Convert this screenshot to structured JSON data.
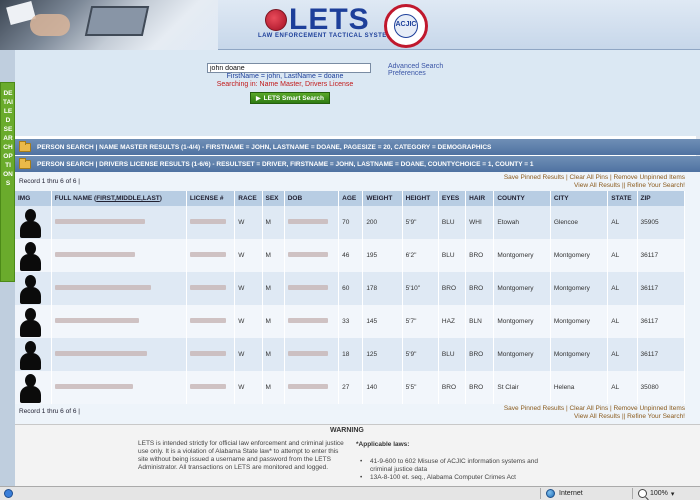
{
  "header": {
    "logo_text": "LETS",
    "logo_subtitle": "LAW ENFORCEMENT TACTICAL SYSTEM",
    "seal_text": "ACJIC"
  },
  "side_strip": {
    "label": "DETAILED SEARCH OPTIONS"
  },
  "search": {
    "value": "john doane",
    "query_echo": "FirstName = john, LastName = doane",
    "scope": "Searching in: Name Master, Drivers License",
    "advanced_link": "Advanced Search",
    "preferences_link": "Preferences",
    "smart_button_label": "LETS Smart Search"
  },
  "result_bars": [
    "PERSON SEARCH | NAME MASTER RESULTS (1-4/4) - FIRSTNAME = JOHN, LASTNAME = DOANE, PAGESIZE = 20, CATEGORY = DEMOGRAPHICS",
    "PERSON SEARCH | DRIVERS LICENSE RESULTS (1-6/6) - RESULTSET = DRIVER, FIRSTNAME = JOHN, LASTNAME = DOANE, COUNTYCHOICE = 1, COUNTY = 1"
  ],
  "pager": {
    "top": "Record 1 thru 6 of 6 |",
    "bottom": "Record 1 thru 6 of 6 |"
  },
  "pin_links": {
    "save_pinned": "Save Pinned Results",
    "clear_pins": "Clear All Pins",
    "remove_unpinned": "Remove Unpinned Items",
    "view_all": "View All Results",
    "refine": "Refine Your Search!"
  },
  "table": {
    "headers": {
      "img": "IMG",
      "full_name_prefix": "FULL NAME (",
      "full_name_link": "FIRST,MIDDLE,LAST",
      "full_name_suffix": ")",
      "license": "LICENSE #",
      "race": "RACE",
      "sex": "SEX",
      "dob": "DOB",
      "age": "AGE",
      "weight": "WEIGHT",
      "height": "HEIGHT",
      "eyes": "EYES",
      "hair": "HAIR",
      "county": "COUNTY",
      "city": "CITY",
      "state": "STATE",
      "zip": "ZIP"
    },
    "rows": [
      {
        "race": "W",
        "sex": "M",
        "age": "70",
        "weight": "200",
        "height": "5'9\"",
        "eyes": "BLU",
        "hair": "WHI",
        "county": "Etowah",
        "city": "Glencoe",
        "state": "AL",
        "zip": "35905"
      },
      {
        "race": "W",
        "sex": "M",
        "age": "46",
        "weight": "195",
        "height": "6'2\"",
        "eyes": "BLU",
        "hair": "BRO",
        "county": "Montgomery",
        "city": "Montgomery",
        "state": "AL",
        "zip": "36117"
      },
      {
        "race": "W",
        "sex": "M",
        "age": "60",
        "weight": "178",
        "height": "5'10\"",
        "eyes": "BRO",
        "hair": "BRO",
        "county": "Montgomery",
        "city": "Montgomery",
        "state": "AL",
        "zip": "36117"
      },
      {
        "race": "W",
        "sex": "M",
        "age": "33",
        "weight": "145",
        "height": "5'7\"",
        "eyes": "HAZ",
        "hair": "BLN",
        "county": "Montgomery",
        "city": "Montgomery",
        "state": "AL",
        "zip": "36117"
      },
      {
        "race": "W",
        "sex": "M",
        "age": "18",
        "weight": "125",
        "height": "5'9\"",
        "eyes": "BLU",
        "hair": "BRO",
        "county": "Montgomery",
        "city": "Montgomery",
        "state": "AL",
        "zip": "36117"
      },
      {
        "race": "W",
        "sex": "M",
        "age": "27",
        "weight": "140",
        "height": "5'5\"",
        "eyes": "BRO",
        "hair": "BRO",
        "county": "St Clair",
        "city": "Helena",
        "state": "AL",
        "zip": "35080"
      }
    ]
  },
  "warning": {
    "title": "WARNING",
    "text": "LETS is intended strictly for official law enforcement and criminal justice use only. It is a violation of Alabama State law* to attempt to enter this site without being issued a username and password from the LETS Administrator. All transactions on LETS are monitored and logged.",
    "laws_title": "*Applicable laws:",
    "laws": [
      "41-9-600 to 602 Misuse of ACJIC information systems and criminal justice data",
      "13A-8-100 et. seq., Alabama Computer Crimes Act"
    ]
  },
  "statusbar": {
    "zone": "Internet",
    "zoom": "100%"
  },
  "colors": {
    "brand_blue": "#1d3f9a",
    "brand_red": "#c0182d",
    "accent_green": "#5aa82a",
    "bar_blue": "#4f72a1"
  }
}
